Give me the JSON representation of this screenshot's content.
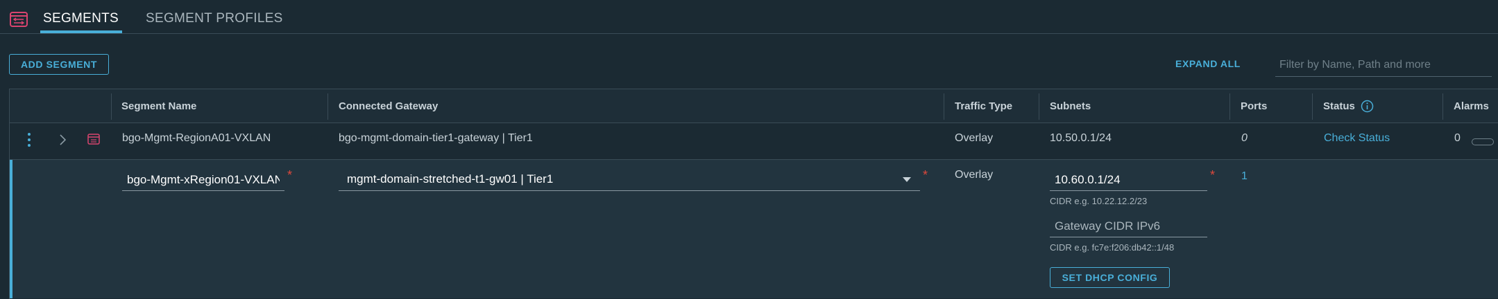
{
  "tabs": [
    {
      "label": "SEGMENTS",
      "active": true
    },
    {
      "label": "SEGMENT PROFILES",
      "active": false
    }
  ],
  "toolbar": {
    "add_label": "ADD SEGMENT",
    "expand_label": "EXPAND ALL",
    "filter_placeholder": "Filter by Name, Path and more"
  },
  "columns": {
    "segment_name": "Segment Name",
    "connected_gateway": "Connected Gateway",
    "traffic_type": "Traffic Type",
    "subnets": "Subnets",
    "ports": "Ports",
    "status": "Status",
    "alarms": "Alarms"
  },
  "rows": [
    {
      "name": "bgo-Mgmt-RegionA01-VXLAN",
      "gateway": "bgo-mgmt-domain-tier1-gateway | Tier1",
      "traffic_type": "Overlay",
      "subnets": "10.50.0.1/24",
      "ports": "0",
      "status": "Check Status",
      "alarms": "0"
    }
  ],
  "edit_row": {
    "name_value": "bgo-Mgmt-xRegion01-VXLAN",
    "gateway_value": "mgmt-domain-stretched-t1-gw01 | Tier1",
    "traffic_type": "Overlay",
    "subnet_value": "10.60.0.1/24",
    "subnet_hint": "CIDR e.g. 10.22.12.2/23",
    "ipv6_placeholder": "Gateway CIDR IPv6",
    "ipv6_hint": "CIDR e.g. fc7e:f206:db42::1/48",
    "dhcp_label": "SET DHCP CONFIG",
    "ports": "1",
    "required_mark": "*"
  },
  "colors": {
    "background": "#1b2a33",
    "accent": "#49afd9",
    "required": "#e0493c",
    "segment_icon": "#d9446f"
  },
  "icons": [
    "segments-icon",
    "kebab-menu-icon",
    "chevron-right-icon",
    "segment-row-icon",
    "info-icon",
    "dropdown-caret-icon"
  ]
}
